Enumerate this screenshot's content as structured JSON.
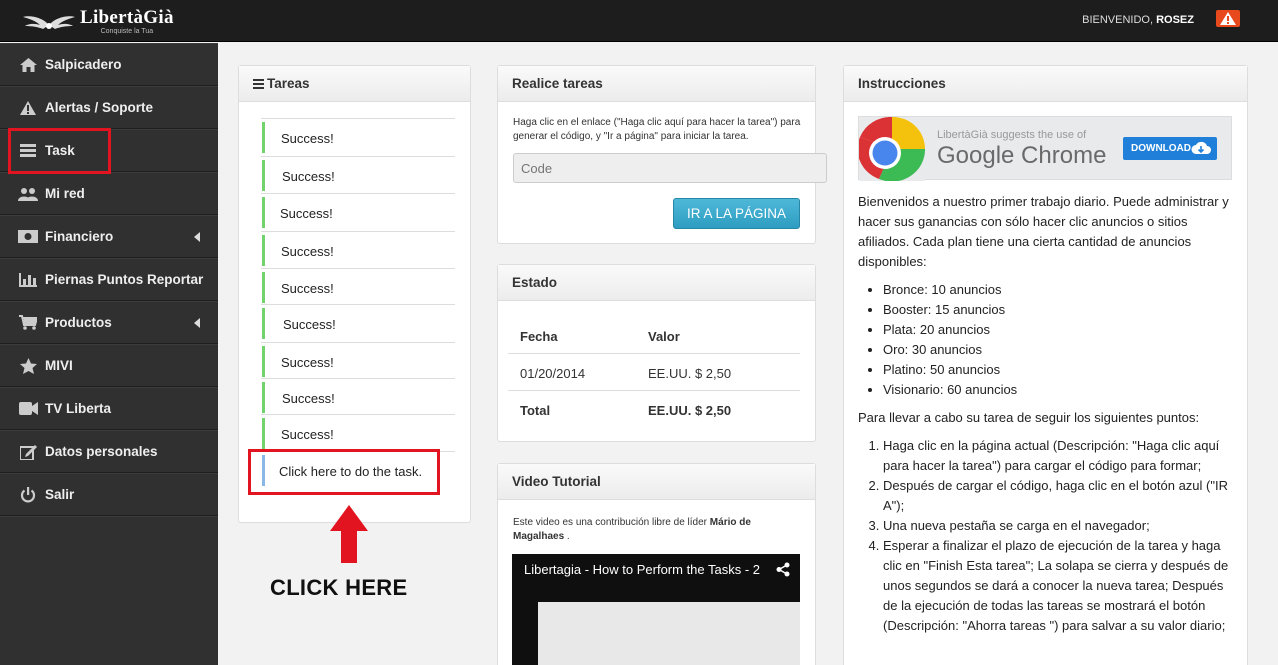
{
  "topbar": {
    "logo_name": "LibertàGià",
    "logo_tag": "Conquiste la Tua",
    "welcome_prefix": "BIENVENIDO, ",
    "welcome_user": "ROSEZ"
  },
  "sidebar": {
    "items": [
      {
        "label": "Salpicadero",
        "icon": "home-icon"
      },
      {
        "label": "Alertas / Soporte",
        "icon": "warning-icon"
      },
      {
        "label": "Task",
        "icon": "list-icon"
      },
      {
        "label": "Mi red",
        "icon": "users-icon"
      },
      {
        "label": "Financiero",
        "icon": "money-icon"
      },
      {
        "label": "Piernas Puntos Reportar",
        "icon": "bar-chart-icon"
      },
      {
        "label": "Productos",
        "icon": "cart-icon"
      },
      {
        "label": "MIVI",
        "icon": "star-icon"
      },
      {
        "label": "TV Liberta",
        "icon": "video-camera-icon"
      },
      {
        "label": "Datos personales",
        "icon": "edit-icon"
      },
      {
        "label": "Salir",
        "icon": "power-icon"
      }
    ]
  },
  "tareas": {
    "title": "Tareas",
    "rows": [
      "Success!",
      "Success!",
      "Success!",
      "Success!",
      "Success!",
      "Success!",
      "Success!",
      "Success!",
      "Success!",
      "Click here to do the task."
    ]
  },
  "annotation": {
    "click_here": "CLICK HERE"
  },
  "realice": {
    "title": "Realice tareas",
    "description": "Haga clic en el enlace (\"Haga clic aquí para hacer la tarea\") para generar el código, y \"Ir a página\" para iniciar la tarea.",
    "code_placeholder": "Code",
    "button_label": "IR A LA PÁGINA"
  },
  "estado": {
    "title": "Estado",
    "header": [
      "Fecha",
      "Valor"
    ],
    "rows": [
      [
        "01/20/2014",
        "EE.UU. $ 2,50"
      ]
    ],
    "total": [
      "Total",
      "EE.UU. $ 2,50"
    ]
  },
  "video": {
    "title": "Video Tutorial",
    "intro": "Este video es una contribución libre de líder ",
    "author": "Mário de Magalhaes",
    "intro_end": " .",
    "video_title": "Libertagia - How to Perform the Tasks - 2"
  },
  "instrucciones": {
    "title": "Instrucciones",
    "ad_small": "LibertàGià suggests the use of",
    "ad_big": "Google Chrome",
    "ad_button": "DOWNLOAD",
    "intro": "Bienvenidos a nuestro primer trabajo diario. Puede administrar y hacer sus ganancias con sólo hacer clic anuncios o sitios afiliados. Cada plan tiene una cierta cantidad de anuncios disponibles:",
    "plans": [
      "Bronce: 10 anuncios",
      "Booster: 15 anuncios",
      "Plata: 20 anuncios",
      "Oro: 30 anuncios",
      "Platino: 50 anuncios",
      "Visionario: 60 anuncios"
    ],
    "steps_intro": "Para llevar a cabo su tarea de seguir los siguientes puntos:",
    "steps": [
      "Haga clic en la página actual (Descripción: \"Haga clic aquí para hacer la tarea\") para cargar el código para formar;",
      "Después de cargar el código, haga clic en el botón azul (\"IR A\");",
      "Una nueva pestaña se carga en el navegador;",
      "Esperar a finalizar el plazo de ejecución de la tarea y haga clic en \"Finish Esta tarea\"; La solapa se cierra y después de unos segundos se dará a conocer la nueva tarea; Después de la ejecución de todas las tareas se mostrará el botón (Descripción: \"Ahorra tareas \") para salvar a su valor diario;"
    ]
  },
  "colors": {
    "accent_blue": "#2d9dc1",
    "success_green": "#72d36c",
    "highlight_red": "#e2141f",
    "sidebar_bg": "#303030"
  }
}
